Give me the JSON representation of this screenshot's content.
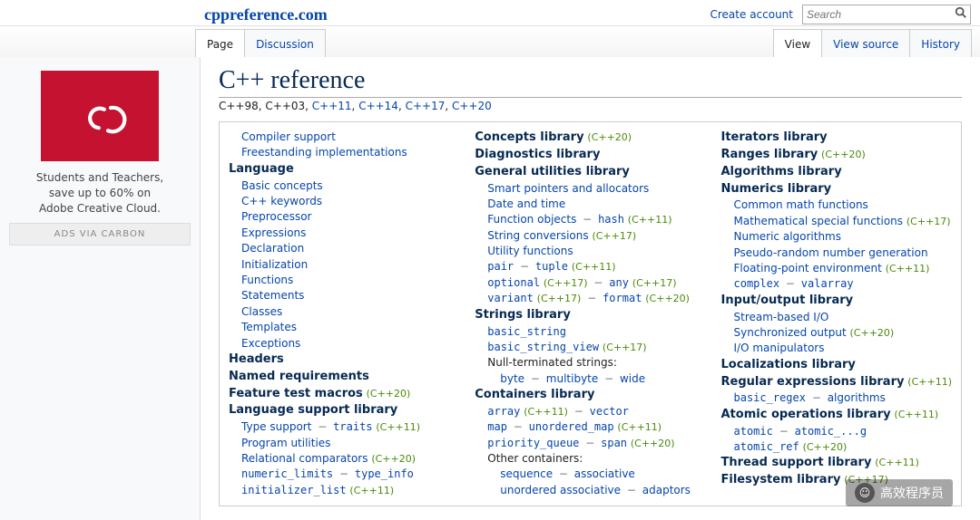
{
  "site": {
    "title": "cppreference.com"
  },
  "topnav": {
    "create_account": "Create account",
    "search_placeholder": "Search"
  },
  "tabs": {
    "page": "Page",
    "discussion": "Discussion",
    "view": "View",
    "view_source": "View source",
    "history": "History"
  },
  "ad": {
    "line1": "Students and Teachers,",
    "line2": "save up to 60% on",
    "line3": "Adobe Creative Cloud.",
    "via": "ADS VIA CARBON"
  },
  "page": {
    "title": "C++ reference",
    "std_plain": "C++98, C++03, ",
    "std11": "C++11",
    "std14": "C++14",
    "std17": "C++17",
    "std20": "C++20"
  },
  "tag": {
    "c11": "(C++11)",
    "c14": "(C++14)",
    "c17": "(C++17)",
    "c20": "(C++20)"
  },
  "sep": {
    "dash": "−",
    "comma": ", "
  },
  "c1": {
    "compiler_support": "Compiler support",
    "freestanding": "Freestanding implementations",
    "language": "Language",
    "basic_concepts": "Basic concepts",
    "keywords": "C++ keywords",
    "preprocessor": "Preprocessor",
    "expressions": "Expressions",
    "declaration": "Declaration",
    "initialization": "Initialization",
    "functions": "Functions",
    "statements": "Statements",
    "classes": "Classes",
    "templates": "Templates",
    "exceptions": "Exceptions",
    "headers": "Headers",
    "named_req": "Named requirements",
    "feature_test": "Feature test macros",
    "lang_support": "Language support library",
    "type_support": "Type support",
    "traits": "traits",
    "program_utils": "Program utilities",
    "relational": "Relational comparators",
    "numeric_limits": "numeric_limits",
    "type_info": "type_info",
    "initializer_list": "initializer_list"
  },
  "c2": {
    "concepts": "Concepts library",
    "diagnostics": "Diagnostics library",
    "general_util": "General utilities library",
    "smart_ptr": "Smart pointers and allocators",
    "datetime": "Date and time",
    "func_obj": "Function objects",
    "hash": "hash",
    "string_conv": "String conversions",
    "util_func": "Utility functions",
    "pair": "pair",
    "tuple": "tuple",
    "optional": "optional",
    "any": "any",
    "variant": "variant",
    "format": "format",
    "strings": "Strings library",
    "basic_string": "basic_string",
    "basic_string_view": "basic_string_view",
    "null_term": "Null-terminated strings:",
    "byte": "byte",
    "multibyte": "multibyte",
    "wide": "wide",
    "containers": "Containers library",
    "array": "array",
    "vector": "vector",
    "map": "map",
    "unordered_map": "unordered_map",
    "priority_queue": "priority_queue",
    "span": "span",
    "other_cont": "Other containers:",
    "sequence": "sequence",
    "associative": "associative",
    "unordered_assoc": "unordered associative",
    "adaptors": "adaptors"
  },
  "c3": {
    "iterators": "Iterators library",
    "ranges": "Ranges library",
    "algorithms": "Algorithms library",
    "numerics": "Numerics library",
    "common_math": "Common math functions",
    "math_special": "Mathematical special functions",
    "numeric_algo": "Numeric algorithms",
    "prng": "Pseudo-random number generation",
    "fp_env": "Floating-point environment",
    "complex": "complex",
    "valarray": "valarray",
    "io": "Input/output library",
    "stream_io": "Stream-based I/O",
    "sync_out": "Synchronized output",
    "io_manip": "I/O manipulators",
    "localizations": "Localizations library",
    "regex": "Regular expressions library",
    "basic_regex": "basic_regex",
    "reg_algorithms": "algorithms",
    "atomic": "Atomic operations library",
    "atomic_t": "atomic",
    "atomic_flag": "atomic_...g",
    "atomic_ref": "atomic_ref",
    "thread": "Thread support library",
    "filesystem": "Filesystem library"
  },
  "watermark": {
    "text": "高效程序员"
  }
}
